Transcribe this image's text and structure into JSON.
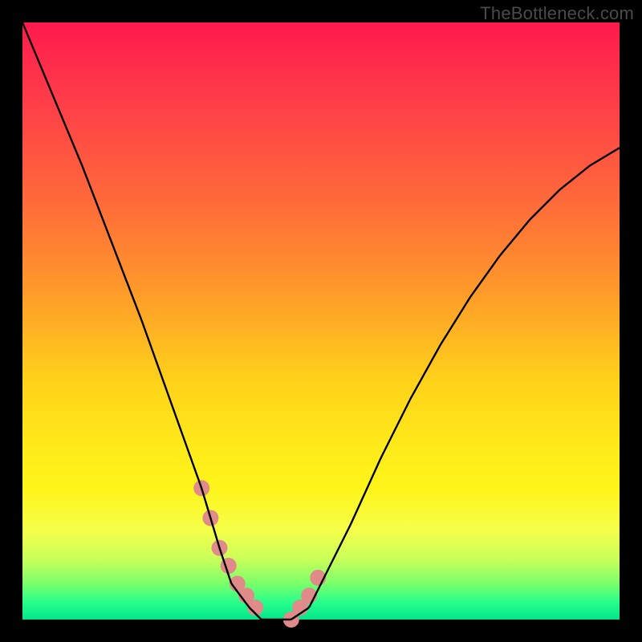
{
  "watermark": "TheBottleneck.com",
  "chart_data": {
    "type": "line",
    "title": "",
    "xlabel": "",
    "ylabel": "",
    "xlim": [
      0,
      100
    ],
    "ylim": [
      0,
      100
    ],
    "grid": false,
    "legend": false,
    "series": [
      {
        "name": "bottleneck-curve",
        "x": [
          0,
          5,
          10,
          15,
          20,
          25,
          30,
          33,
          35,
          38,
          40,
          43,
          45,
          48,
          50,
          55,
          60,
          65,
          70,
          75,
          80,
          85,
          90,
          95,
          100
        ],
        "values": [
          100,
          88,
          76,
          63,
          50,
          36,
          22,
          12,
          6,
          2,
          0,
          0,
          0,
          2,
          6,
          16,
          27,
          37,
          46,
          54,
          61,
          67,
          72,
          76,
          79
        ]
      }
    ],
    "markers": {
      "name": "highlight-dots",
      "color": "#e08a8a",
      "radius_px": 10,
      "x": [
        30,
        31.5,
        33,
        34.5,
        36,
        37.5,
        39,
        45,
        46.5,
        48,
        49.5
      ],
      "values": [
        22,
        17,
        12,
        9,
        6,
        4,
        2,
        0,
        2,
        4,
        7
      ]
    }
  },
  "colors": {
    "curve": "#000000",
    "marker": "#e08a8a",
    "frame": "#000000"
  }
}
